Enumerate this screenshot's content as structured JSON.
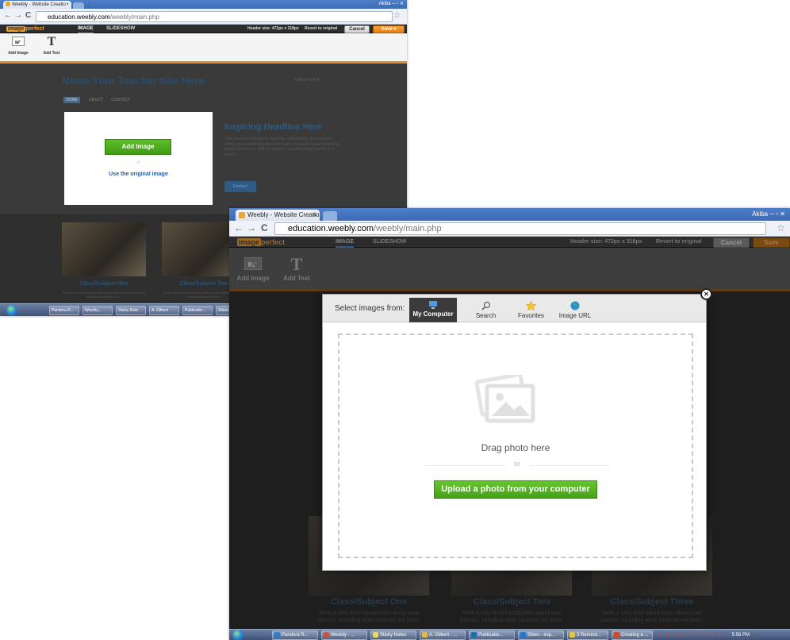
{
  "colors": {
    "accent_orange": "#e58b2b",
    "green_button": "#4fae1f",
    "blue_link": "#2a5ca8",
    "chrome_tab_blue": "#3b6bb5"
  },
  "browser": {
    "tab_title_back": "Weebly - Website Creatio",
    "tab_title_front": "Weebly - Website Creatio",
    "tab_close": "×",
    "url_host": "education.weebly.com",
    "url_path": "/weebly/main.php",
    "window_controls": "Akiba  ─  ▫  ✕",
    "nav_back": "←",
    "nav_forward": "→",
    "nav_reload": "C",
    "bookmark_star": "☆"
  },
  "editor": {
    "logo_prefix": "image",
    "logo_suffix": "perfect",
    "tab_image": "IMAGE",
    "tab_slideshow": "SLIDESHOW",
    "header_size": "Header size: 472px x 318px",
    "revert": "Revert to original",
    "cancel": "Cancel",
    "save": "Save",
    "save_arrow": "▾",
    "tool_add_image": "Add Image",
    "tool_add_text": "Add Text",
    "tool_text_glyph": "T"
  },
  "site": {
    "title": "Name Your Teacher Site Here",
    "nav": [
      "HOME",
      "ABOUT",
      "CONTACT"
    ],
    "social": "Follow  f  t  in  ✉",
    "headline": "Inspiring Headline Here",
    "blurb": "Your lead here should be inspiring, motivational, and perhaps reflect your overall teaching philosophy. It doesn't have to be long. And if you are in a club for society, consider using a quote or a poem!",
    "cta": "Contact",
    "class_titles": [
      "Class/Subject One",
      "Class/Subject Two",
      "Class/Subject Three"
    ],
    "class_desc": "Write a very brief introduction about your classes, including what students will learn."
  },
  "placeholder": {
    "add_image": "Add Image",
    "or": "or",
    "use_original": "Use the original image"
  },
  "modal": {
    "select_from": "Select images from:",
    "tabs": [
      {
        "label": "My Computer",
        "icon": "computer-icon"
      },
      {
        "label": "Search",
        "icon": "search-icon"
      },
      {
        "label": "Favorites",
        "icon": "star-icon"
      },
      {
        "label": "Image URL",
        "icon": "globe-icon"
      }
    ],
    "drag_text": "Drag photo here",
    "or": "or",
    "upload_button": "Upload a photo from your computer",
    "close": "✕"
  },
  "taskbar_back": {
    "items": [
      "Pandora R...",
      "Weebly...",
      "Sticky Note",
      "A. Gilbert",
      "Publicatio...",
      "Sibes"
    ]
  },
  "taskbar_front": {
    "items": [
      "Pandora R...",
      "Weebly - ...",
      "Sticky Notes",
      "A. Gilbert - ...",
      "Publicatio...",
      "Sibes - esp...",
      "3 Remind...",
      "Creating a ..."
    ],
    "clock": "5:56 PM"
  }
}
